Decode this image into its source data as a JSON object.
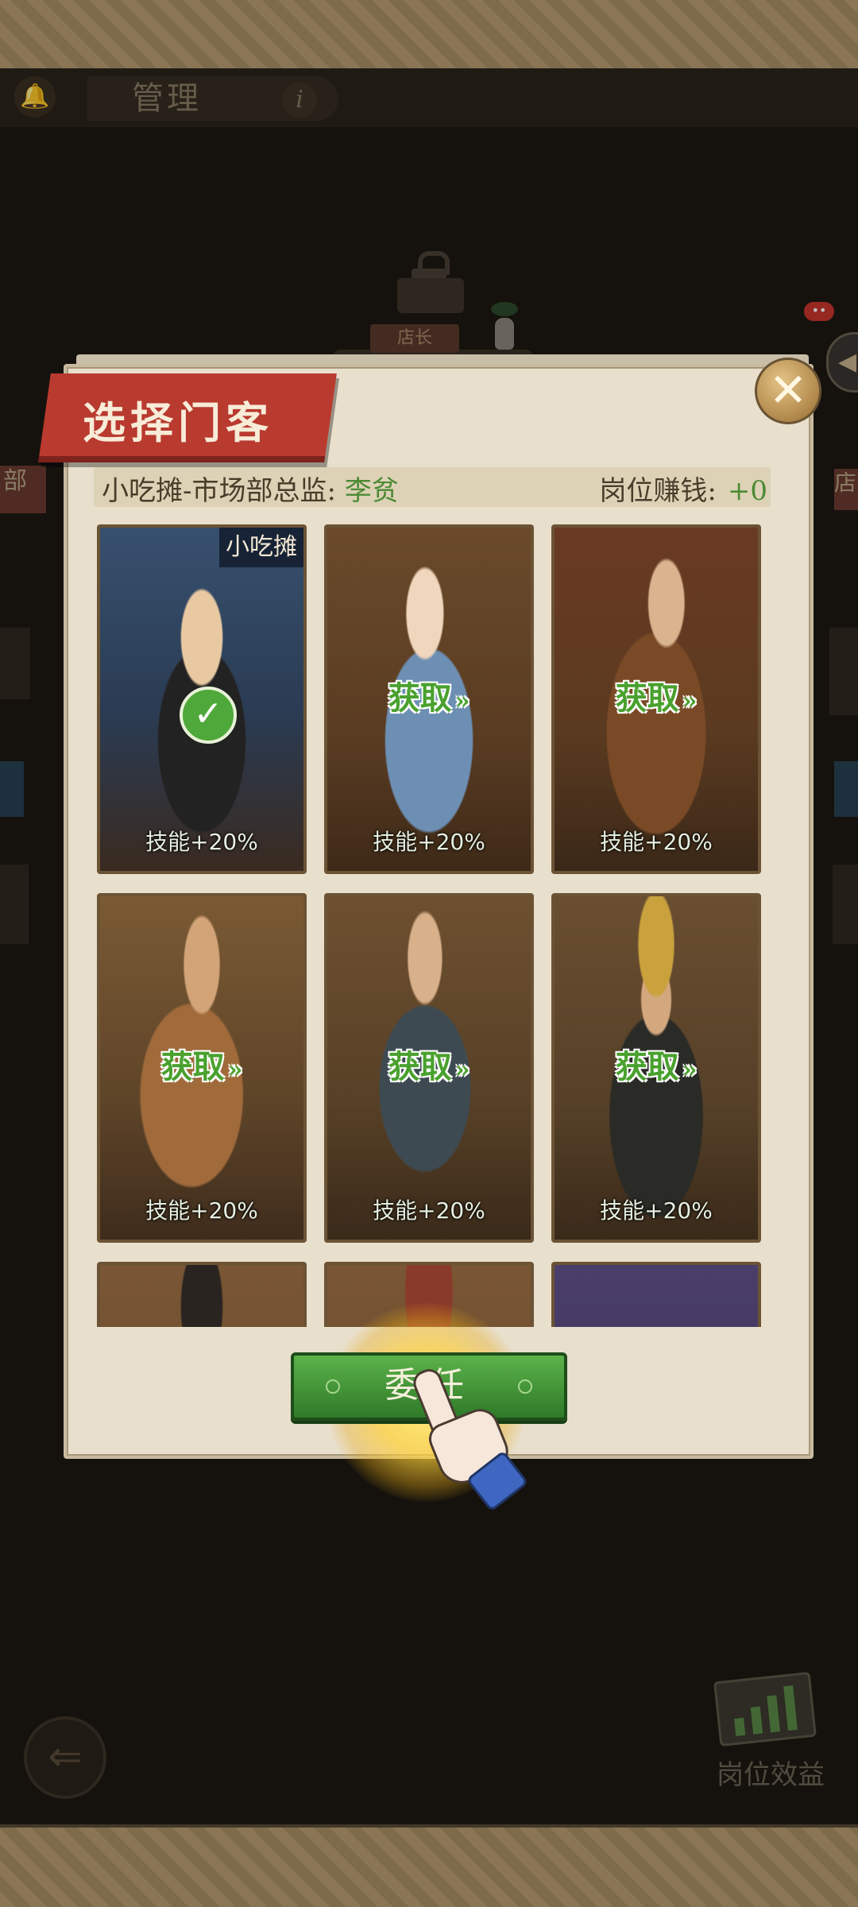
{
  "header": {
    "title": "管理",
    "info_icon": "i"
  },
  "background": {
    "shopkeeper_label": "店长",
    "left_tab": "部",
    "right_tab": "店",
    "notification_dots": "••",
    "side_arrow_icon": "◀",
    "job_benefit_label": "岗位效益"
  },
  "dialog": {
    "title": "选择门客",
    "position_label": "小吃摊-市场部总监: ",
    "assignee_name": "李贫",
    "earn_label": "岗位赚钱:",
    "earn_value": "+0",
    "close_icon": "✕",
    "appoint_button": "委任"
  },
  "cards": [
    {
      "skill": "技能+20%",
      "obtain": "",
      "shop_tag": "小吃摊",
      "selected": true
    },
    {
      "skill": "技能+20%",
      "obtain": "获取",
      "shop_tag": "",
      "selected": false
    },
    {
      "skill": "技能+20%",
      "obtain": "获取",
      "shop_tag": "",
      "selected": false
    },
    {
      "skill": "技能+20%",
      "obtain": "获取",
      "shop_tag": "",
      "selected": false
    },
    {
      "skill": "技能+20%",
      "obtain": "获取",
      "shop_tag": "",
      "selected": false
    },
    {
      "skill": "技能+20%",
      "obtain": "获取",
      "shop_tag": "",
      "selected": false
    },
    {
      "skill": "",
      "obtain": "",
      "shop_tag": "",
      "selected": false
    },
    {
      "skill": "",
      "obtain": "",
      "shop_tag": "",
      "selected": false
    },
    {
      "skill": "",
      "obtain": "",
      "shop_tag": "",
      "selected": false
    }
  ],
  "colors": {
    "accent_green": "#49a12e",
    "title_red": "#b93a2f",
    "dialog_paper": "#e8dfcc"
  }
}
